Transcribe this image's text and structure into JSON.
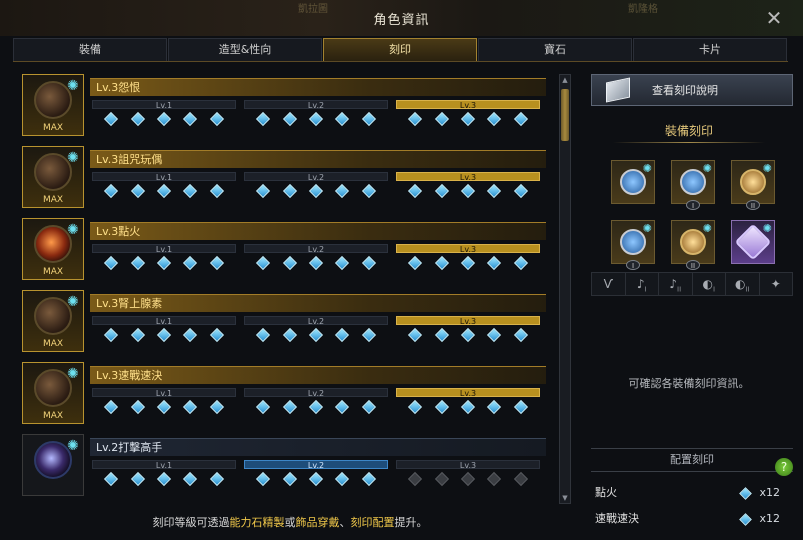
{
  "window": {
    "title": "角色資訊",
    "bg_left": "凱拉圖",
    "bg_right": "凱隆格"
  },
  "tabs": [
    {
      "label": "裝備",
      "active": false
    },
    {
      "label": "造型&性向",
      "active": false
    },
    {
      "label": "刻印",
      "active": true
    },
    {
      "label": "寶石",
      "active": false
    },
    {
      "label": "卡片",
      "active": false
    }
  ],
  "engravings": [
    {
      "name": "Lv.3怨恨",
      "max": "MAX",
      "level": 3,
      "levels": [
        "Lv.1",
        "Lv.2",
        "Lv.3"
      ],
      "filled": 15
    },
    {
      "name": "Lv.3詛咒玩偶",
      "max": "MAX",
      "level": 3,
      "levels": [
        "Lv.1",
        "Lv.2",
        "Lv.3"
      ],
      "filled": 15
    },
    {
      "name": "Lv.3點火",
      "max": "MAX",
      "level": 3,
      "levels": [
        "Lv.1",
        "Lv.2",
        "Lv.3"
      ],
      "filled": 15
    },
    {
      "name": "Lv.3腎上腺素",
      "max": "MAX",
      "level": 3,
      "levels": [
        "Lv.1",
        "Lv.2",
        "Lv.3"
      ],
      "filled": 15
    },
    {
      "name": "Lv.3速戰速決",
      "max": "MAX",
      "level": 3,
      "levels": [
        "Lv.1",
        "Lv.2",
        "Lv.3"
      ],
      "filled": 15
    },
    {
      "name": "Lv.2打擊高手",
      "max": "",
      "level": 2,
      "levels": [
        "Lv.1",
        "Lv.2",
        "Lv.3"
      ],
      "filled": 10
    }
  ],
  "footer": {
    "pre": "刻印等級可透過",
    "hl1": "能力石精製",
    "mid1": "或",
    "hl2": "飾品穿戴",
    "mid2": "、",
    "hl3": "刻印配置",
    "post": "提升。"
  },
  "right": {
    "desc_button": "查看刻印說明",
    "equipped_title": "裝備刻印",
    "slots": [
      {
        "icon": "necklace-icon",
        "rank": ""
      },
      {
        "icon": "earring-icon",
        "rank": "I"
      },
      {
        "icon": "earring-icon",
        "rank": "II"
      },
      {
        "icon": "ring-icon",
        "rank": "I"
      },
      {
        "icon": "ring-icon",
        "rank": "II"
      },
      {
        "icon": "ability-stone-icon",
        "rank": ""
      }
    ],
    "filters": [
      {
        "icon": "necklace-icon",
        "glyph": "Ѵ",
        "sub": ""
      },
      {
        "icon": "earring-icon",
        "glyph": "♪",
        "sub": "I"
      },
      {
        "icon": "earring-icon",
        "glyph": "♪",
        "sub": "II"
      },
      {
        "icon": "ring-icon",
        "glyph": "◐",
        "sub": "I"
      },
      {
        "icon": "ring-icon",
        "glyph": "◐",
        "sub": "II"
      },
      {
        "icon": "ability-stone-icon",
        "glyph": "✦",
        "sub": ""
      }
    ],
    "hint": "可確認各裝備刻印資訊。",
    "config_title": "配置刻印",
    "help": "?",
    "config": [
      {
        "name": "點火",
        "amount": "x12"
      },
      {
        "name": "速戰速決",
        "amount": "x12"
      }
    ]
  },
  "colors": {
    "accent": "#b8901f",
    "engrave_gem": "#2a92d4",
    "highlight": "#f0c84a"
  }
}
